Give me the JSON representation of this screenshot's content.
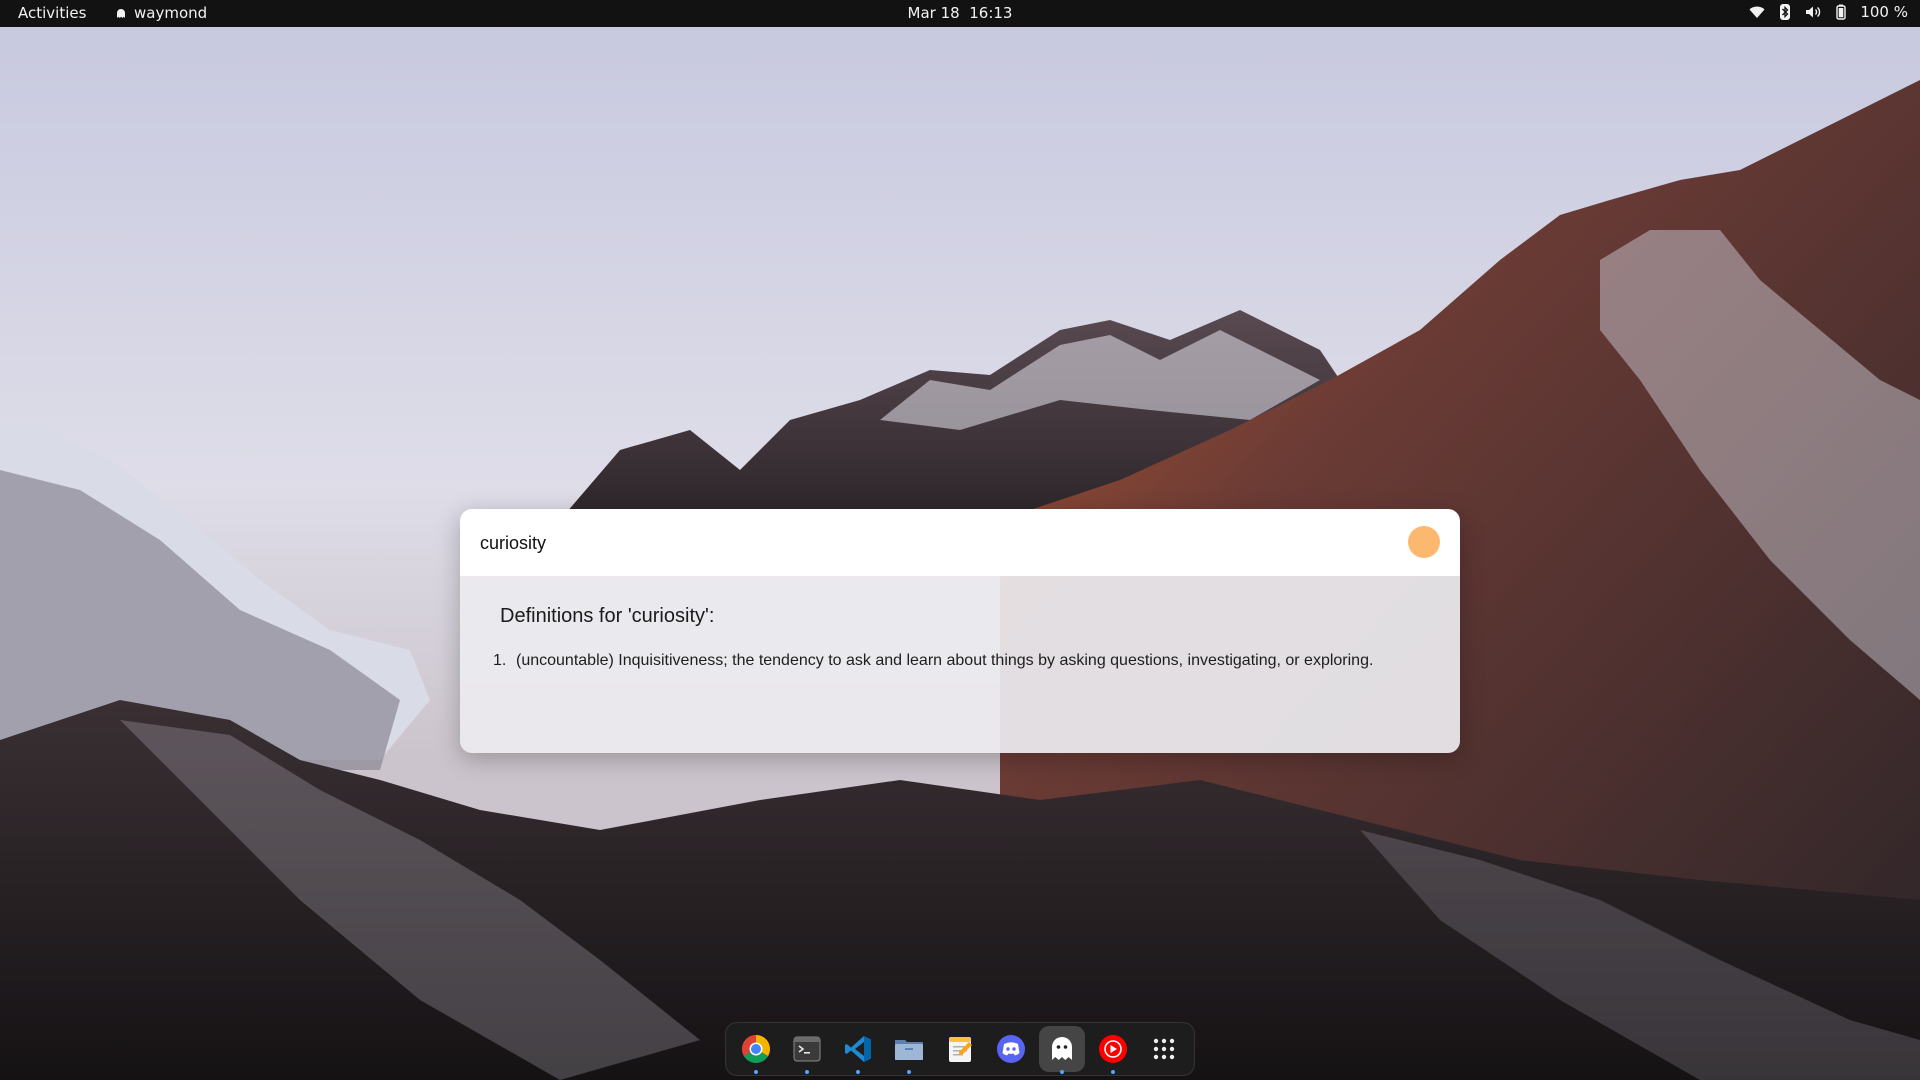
{
  "topbar": {
    "activities_label": "Activities",
    "app_name": "waymond",
    "app_icon": "ghost-icon",
    "date": "Mar 18",
    "time": "16:13",
    "battery_percent": "100 %",
    "tray_icons": [
      "wifi-icon",
      "bluetooth-icon",
      "volume-icon",
      "battery-icon"
    ]
  },
  "popup": {
    "query": "curiosity",
    "status_color": "#fbb86e",
    "result_title": "Definitions for 'curiosity':",
    "definitions": [
      {
        "number": "1.",
        "text": "(uncountable) Inquisitiveness; the tendency to ask and learn about things by asking questions, investigating, or exploring."
      }
    ]
  },
  "dock": {
    "items": [
      {
        "name": "chrome-icon",
        "running": true,
        "active": false
      },
      {
        "name": "terminal-icon",
        "running": true,
        "active": false
      },
      {
        "name": "vscode-icon",
        "running": true,
        "active": false
      },
      {
        "name": "files-icon",
        "running": true,
        "active": false
      },
      {
        "name": "text-editor-icon",
        "running": false,
        "active": false
      },
      {
        "name": "discord-icon",
        "running": false,
        "active": false
      },
      {
        "name": "ghost-icon",
        "running": true,
        "active": true
      },
      {
        "name": "youtube-music-icon",
        "running": true,
        "active": false
      },
      {
        "name": "app-grid-icon",
        "running": false,
        "active": false
      }
    ]
  },
  "colors": {
    "topbar_bg": "#121212",
    "dock_running_dot": "#5aa0ff"
  }
}
